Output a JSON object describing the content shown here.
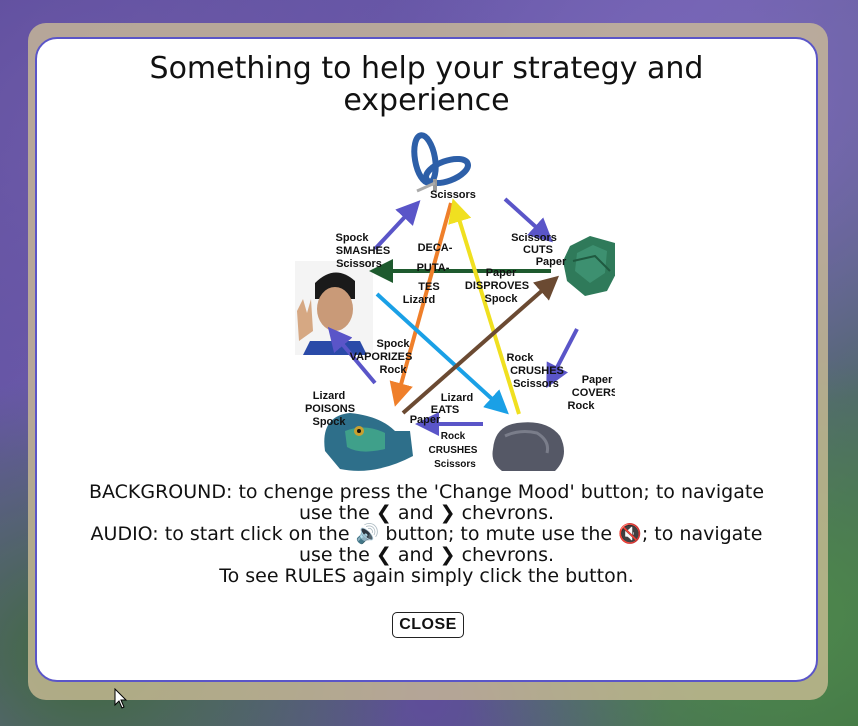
{
  "modal": {
    "title_line1": "Something to help your strategy and",
    "title_line2": "experience",
    "close_label": "CLOSE"
  },
  "diagram": {
    "labels": {
      "scissors": "Scissors",
      "spock_smashes": [
        "Spock",
        "SMASHES",
        "Scissors"
      ],
      "scissors_cuts": [
        "Scissors",
        "CUTS",
        "Paper"
      ],
      "decapitates": [
        "DECA-",
        "PUTA-",
        "TES",
        "Lizard"
      ],
      "paper_disproves": [
        "Paper",
        "DISPROVES",
        "Spock"
      ],
      "spock_vaporizes": [
        "Spock",
        "VAPORIZES",
        "Rock"
      ],
      "rock_crushes_mid": [
        "Rock",
        "CRUSHES",
        "Scissors"
      ],
      "paper_covers": [
        "Paper",
        "COVERS",
        "Rock"
      ],
      "lizard_poisons": [
        "Lizard",
        "POISONS",
        "Spock"
      ],
      "lizard_eats": [
        "Lizard",
        "EATS",
        "Paper"
      ],
      "rock_crushes_bottom": [
        "Rock",
        "CRUSHES",
        "Scissors"
      ]
    }
  },
  "info": {
    "line1": "BACKGROUND: to chenge press the 'Change Mood' button; to navigate",
    "line2a": "use the",
    "and": "and",
    "chevrons": "chevrons.",
    "line3a": "AUDIO: to start click on the",
    "line3b": "button; to mute use the",
    "line3c": "; to navigate",
    "line5": "To see RULES again simply click the button."
  }
}
